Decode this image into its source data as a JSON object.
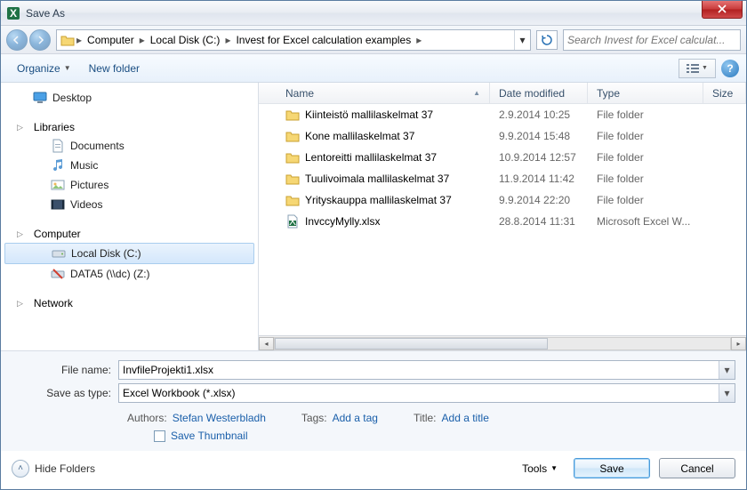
{
  "window": {
    "title": "Save As"
  },
  "breadcrumbs": {
    "b1": "Computer",
    "b2": "Local Disk (C:)",
    "b3": "Invest for Excel calculation examples"
  },
  "search": {
    "placeholder": "Search Invest for Excel calculat..."
  },
  "toolbar": {
    "organize": "Organize",
    "new_folder": "New folder"
  },
  "sidebar": {
    "desktop": "Desktop",
    "libraries": "Libraries",
    "documents": "Documents",
    "music": "Music",
    "pictures": "Pictures",
    "videos": "Videos",
    "computer": "Computer",
    "local_disk": "Local Disk (C:)",
    "data5": "DATA5 (\\\\dc) (Z:)",
    "network": "Network"
  },
  "columns": {
    "name": "Name",
    "date": "Date modified",
    "type": "Type",
    "size": "Size"
  },
  "files": {
    "r0": {
      "name": "Kiinteistö mallilaskelmat 37",
      "date": "2.9.2014 10:25",
      "type": "File folder"
    },
    "r1": {
      "name": "Kone mallilaskelmat 37",
      "date": "9.9.2014 15:48",
      "type": "File folder"
    },
    "r2": {
      "name": "Lentoreitti mallilaskelmat 37",
      "date": "10.9.2014 12:57",
      "type": "File folder"
    },
    "r3": {
      "name": "Tuulivoimala mallilaskelmat 37",
      "date": "11.9.2014 11:42",
      "type": "File folder"
    },
    "r4": {
      "name": "Yrityskauppa mallilaskelmat 37",
      "date": "9.9.2014 22:20",
      "type": "File folder"
    },
    "r5": {
      "name": "InvccyMylly.xlsx",
      "date": "28.8.2014 11:31",
      "type": "Microsoft Excel W..."
    }
  },
  "fields": {
    "filename_label": "File name:",
    "filename_value": "InvfileProjekti1.xlsx",
    "saveastype_label": "Save as type:",
    "saveastype_value": "Excel Workbook (*.xlsx)"
  },
  "meta": {
    "authors_label": "Authors:",
    "authors_value": "Stefan Westerbladh",
    "tags_label": "Tags:",
    "tags_value": "Add a tag",
    "title_label": "Title:",
    "title_value": "Add a title",
    "save_thumbnail": "Save Thumbnail"
  },
  "footer": {
    "hide_folders": "Hide Folders",
    "tools": "Tools",
    "save": "Save",
    "cancel": "Cancel"
  }
}
